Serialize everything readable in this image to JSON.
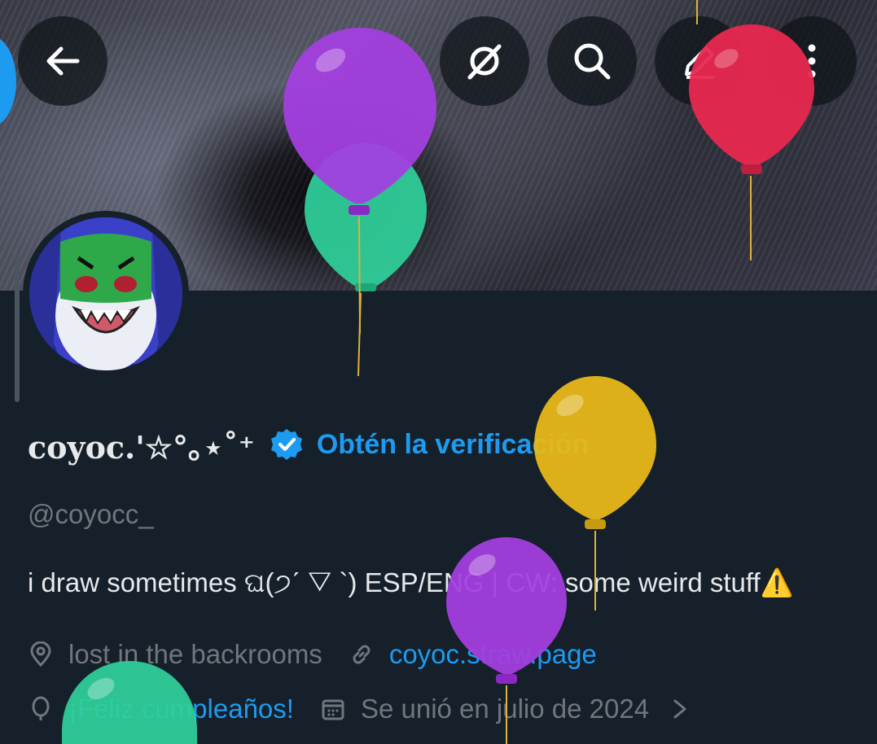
{
  "header": {
    "back_icon": "arrow-left-icon",
    "grok_icon": "grok-icon",
    "search_icon": "search-icon",
    "compose_icon": "compose-icon",
    "more_icon": "more-vertical-icon"
  },
  "profile": {
    "display_name": "coyoc.'☆°｡⋆˚⁺",
    "verify_link": "Obtén la verificación",
    "handle": "@coyocc_",
    "bio": "i draw sometimes ଘ(੭ˊ ▽ `) ESP/ENG | CW: some weird stuff⚠️",
    "location": "lost in the backrooms",
    "website": "coyoc.straw.page",
    "birthday": "¡Feliz cumpleaños!",
    "joined": "Se unió en julio de 2024"
  },
  "colors": {
    "background": "#15202b",
    "accent": "#1d9bf0",
    "muted": "#71767b",
    "text": "#e7e9ea"
  }
}
